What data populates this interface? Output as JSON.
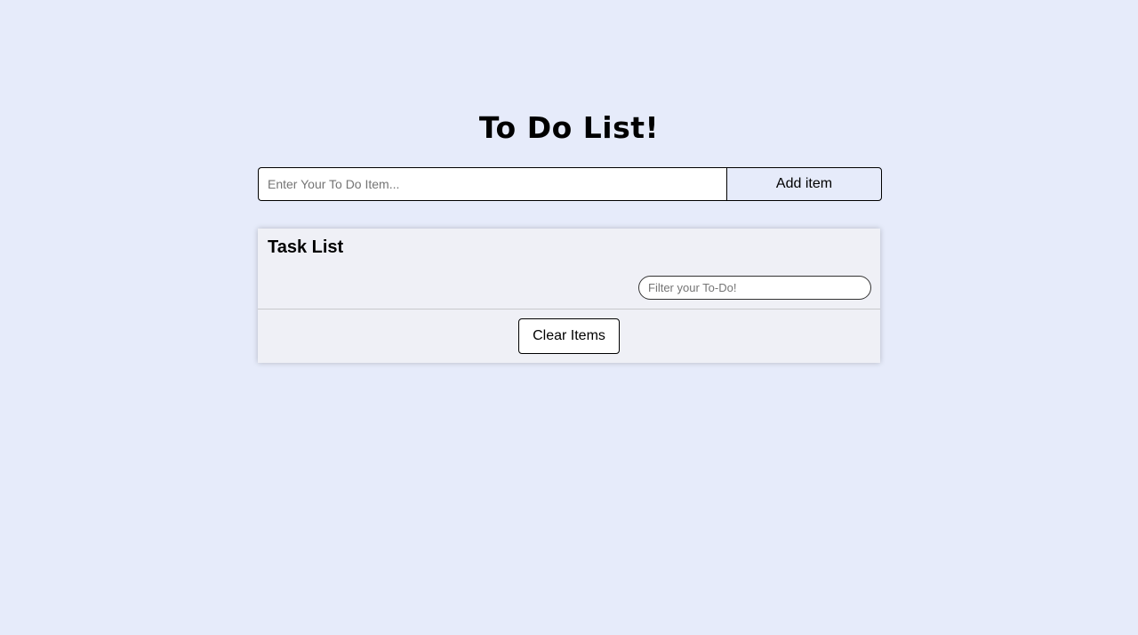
{
  "header": {
    "title": "To Do List!"
  },
  "add_form": {
    "input_placeholder": "Enter Your To Do Item...",
    "input_value": "",
    "button_label": "Add item"
  },
  "task_panel": {
    "heading": "Task List",
    "filter_placeholder": "Filter your To-Do!",
    "filter_value": "",
    "items": [],
    "clear_button_label": "Clear Items"
  },
  "colors": {
    "background": "#e6ebfa",
    "panel": "#eff0f6"
  }
}
